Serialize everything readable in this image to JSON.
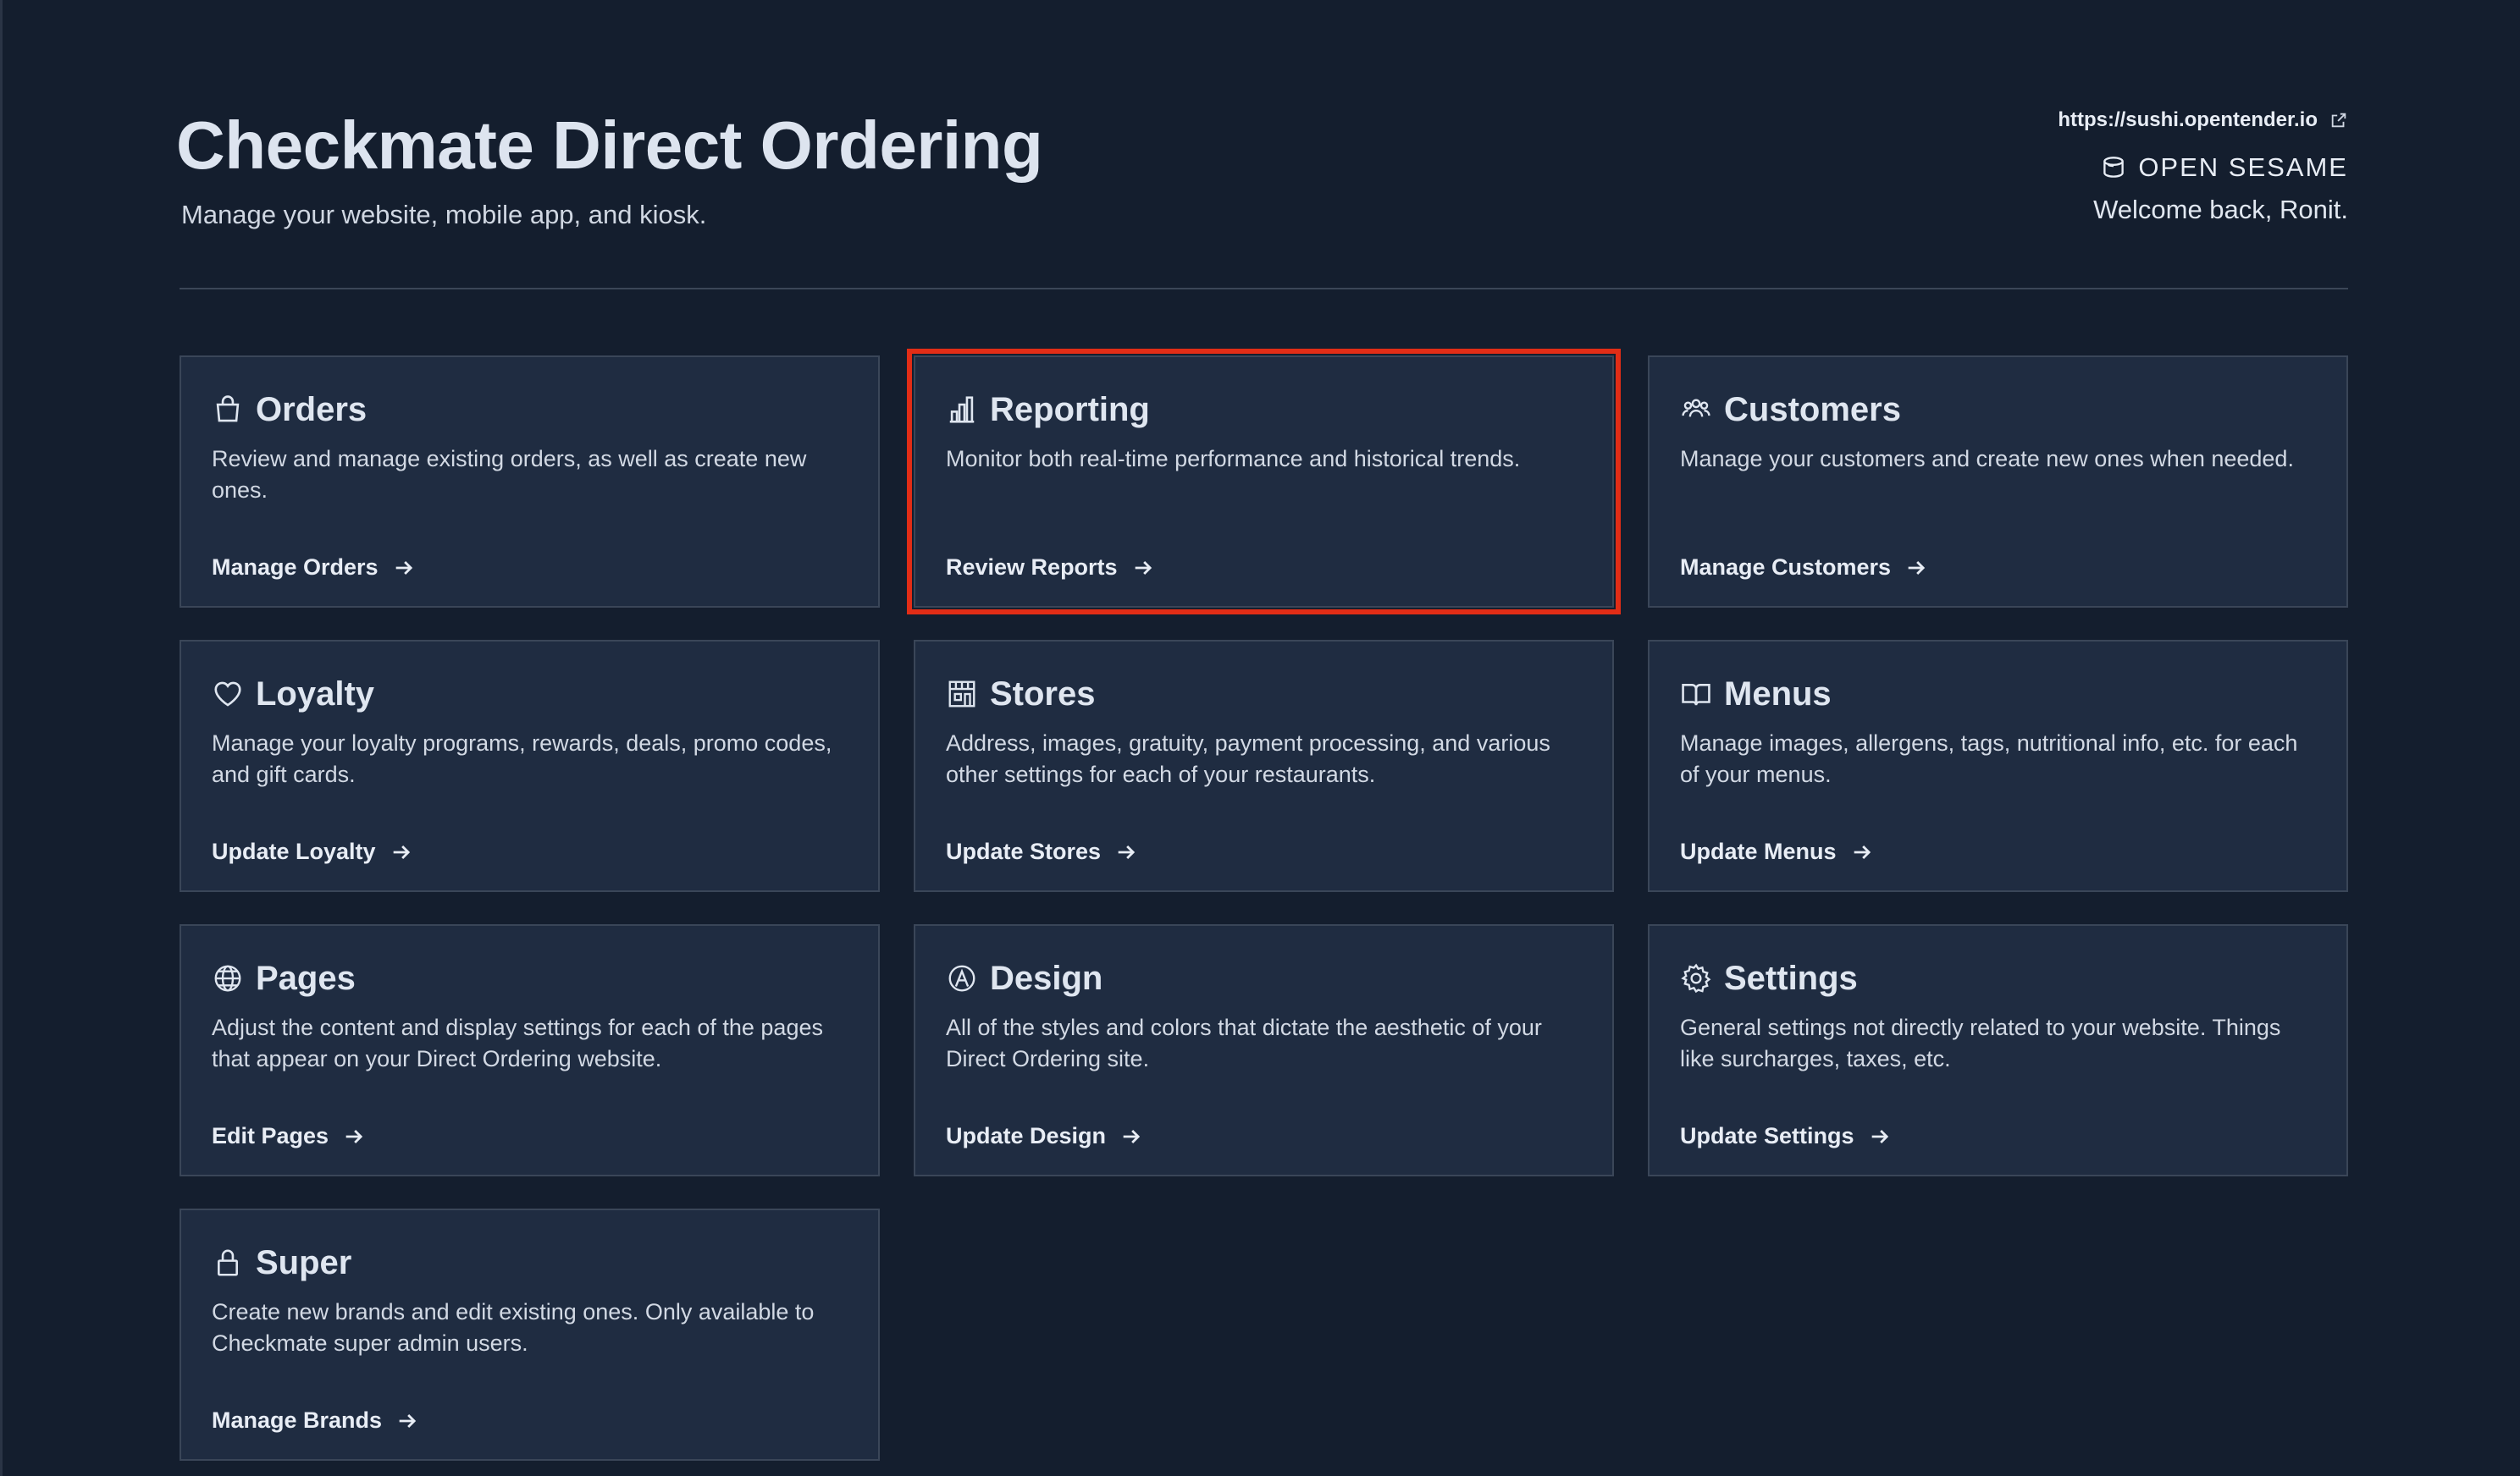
{
  "header": {
    "title": "Checkmate Direct Ordering",
    "subtitle": "Manage your website, mobile app, and kiosk.",
    "site_url": "https://sushi.opentender.io",
    "brand": "OPEN SESAME",
    "welcome": "Welcome back, Ronit."
  },
  "cards": [
    {
      "icon": "shopping-bag-icon",
      "title": "Orders",
      "description": "Review and manage existing orders, as well as create new ones.",
      "link": "Manage Orders"
    },
    {
      "icon": "bar-chart-icon",
      "title": "Reporting",
      "description": "Monitor both real-time performance and historical trends.",
      "link": "Review Reports"
    },
    {
      "icon": "users-icon",
      "title": "Customers",
      "description": "Manage your customers and create new ones when needed.",
      "link": "Manage Customers"
    },
    {
      "icon": "heart-icon",
      "title": "Loyalty",
      "description": "Manage your loyalty programs, rewards, deals, promo codes, and gift cards.",
      "link": "Update Loyalty"
    },
    {
      "icon": "storefront-icon",
      "title": "Stores",
      "description": "Address, images, gratuity, payment processing, and various other settings for each of your restaurants.",
      "link": "Update Stores"
    },
    {
      "icon": "book-open-icon",
      "title": "Menus",
      "description": "Manage images, allergens, tags, nutritional info, etc. for each of your menus.",
      "link": "Update Menus"
    },
    {
      "icon": "globe-icon",
      "title": "Pages",
      "description": "Adjust the content and display settings for each of the pages that appear on your Direct Ordering website.",
      "link": "Edit Pages"
    },
    {
      "icon": "design-icon",
      "title": "Design",
      "description": "All of the styles and colors that dictate the aesthetic of your Direct Ordering site.",
      "link": "Update Design"
    },
    {
      "icon": "gear-icon",
      "title": "Settings",
      "description": "General settings not directly related to your website. Things like surcharges, taxes, etc.",
      "link": "Update Settings"
    },
    {
      "icon": "lock-icon",
      "title": "Super",
      "description": "Create new brands and edit existing ones. Only available to Checkmate super admin users.",
      "link": "Manage Brands"
    }
  ],
  "colors": {
    "background": "#141e2e",
    "card": "#1f2c41",
    "highlight": "#e22d16"
  }
}
